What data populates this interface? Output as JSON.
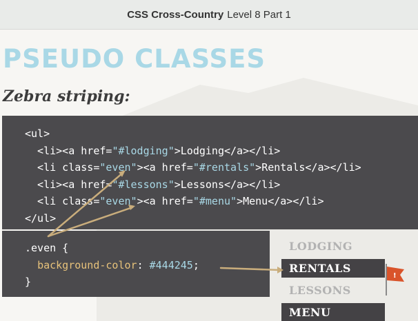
{
  "header": {
    "course": "CSS Cross-Country",
    "section": "Level 8 Part 1"
  },
  "slide": {
    "heading": "PSEUDO CLASSES",
    "subheading": "Zebra striping:",
    "html_code": {
      "ul_open": "<ul>",
      "lines": [
        {
          "pre": "  <li><a href=",
          "val": "\"#lodging\"",
          "mid": ">",
          "text": "Lodging",
          "post": "</a></li>"
        },
        {
          "pre": "  <li class=",
          "cls": "\"even\"",
          "mid0": "><a href=",
          "val": "\"#rentals\"",
          "mid": ">",
          "text": "Rentals",
          "post": "</a></li>"
        },
        {
          "pre": "  <li><a href=",
          "val": "\"#lessons\"",
          "mid": ">",
          "text": "Lessons",
          "post": "</a></li>"
        },
        {
          "pre": "  <li class=",
          "cls": "\"even\"",
          "mid0": "><a href=",
          "val": "\"#menu\"",
          "mid": ">",
          "text": "Menu",
          "post": "</a></li>"
        }
      ],
      "ul_close": "</ul>"
    },
    "css_code": {
      "selector_line": ".even {",
      "prop": "background-color",
      "colon": ": ",
      "value": "#444245",
      "semi": ";",
      "close": "}"
    },
    "demo_list": [
      "LODGING",
      "RENTALS",
      "LESSONS",
      "MENU"
    ],
    "flag_mark": "!"
  },
  "colors": {
    "code_bg": "#4b4a4d",
    "heading": "#a9d8e6",
    "even_bg": "#444245",
    "arrow": "#c9ad7c",
    "flag": "#d9542b"
  }
}
